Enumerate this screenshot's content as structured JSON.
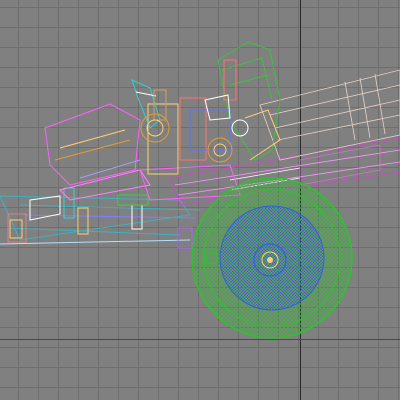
{
  "viewport": {
    "view": "side",
    "display_mode": "wireframe",
    "background_color": "#808080",
    "grid_color": "#6e6e6e",
    "axis_color": "#2a2a2a"
  },
  "model": {
    "subject": "field gun",
    "parts": [
      {
        "name": "barrel",
        "color": "#c050c0"
      },
      {
        "name": "recoil-cylinder",
        "color": "#e6d2c8"
      },
      {
        "name": "wheel",
        "color": "#30c030"
      },
      {
        "name": "wheel-hub",
        "color": "#3060e0"
      },
      {
        "name": "trail",
        "color": "#40b0c0"
      },
      {
        "name": "shield",
        "color": "#40c040"
      },
      {
        "name": "cradle",
        "color": "#ff60ff"
      },
      {
        "name": "sight",
        "color": "#30d0d0"
      },
      {
        "name": "elevation-gear",
        "color": "#e0a030"
      }
    ]
  }
}
